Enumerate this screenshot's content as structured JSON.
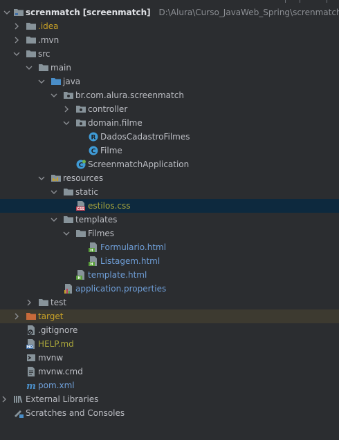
{
  "tree": {
    "root": {
      "label": "screnmatch",
      "module": "[screenmatch]",
      "path": "D:\\Alura\\Curso_JavaWeb_Spring\\screnmatch"
    },
    "idea": ".idea",
    "mvn": ".mvn",
    "src": "src",
    "main": "main",
    "java": "java",
    "package": "br.com.alura.screenmatch",
    "controller": "controller",
    "domain": "domain.filme",
    "dados": "DadosCadastroFilmes",
    "filme": "Filme",
    "app": "ScreenmatchApplication",
    "resources": "resources",
    "static": "static",
    "estilos": "estilos.css",
    "templates": "templates",
    "filmes": "Filmes",
    "formulario": "Formulario.html",
    "listagem": "Listagem.html",
    "template": "template.html",
    "appprops": "application.properties",
    "test": "test",
    "target": "target",
    "gitignore": ".gitignore",
    "help": "HELP.md",
    "mvnw": "mvnw",
    "mvnwcmd": "mvnw.cmd",
    "pom": "pom.xml",
    "extlibs": "External Libraries",
    "scratches": "Scratches and Consoles"
  },
  "colors": {
    "folder": "#87939a",
    "source_folder": "#4a8ec8",
    "resources_folder": "#8f8f6b",
    "target_folder": "#c76a3a",
    "interface_icon": "#3f9bd6",
    "class_icon": "#3f9bd6"
  }
}
